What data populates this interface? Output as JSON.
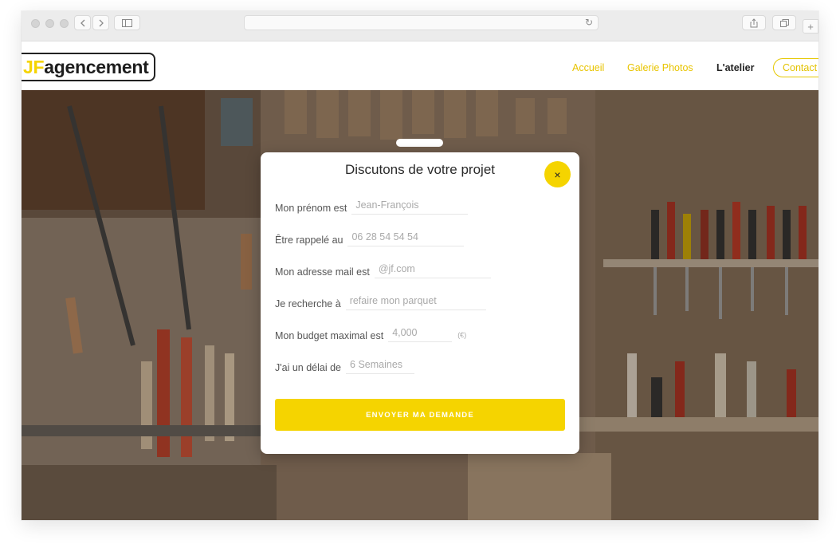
{
  "browser": {
    "back_icon": "chevron-left-icon",
    "forward_icon": "chevron-right-icon",
    "sidebar_icon": "sidebar-icon",
    "reload_icon": "reload-icon",
    "share_icon": "share-icon",
    "tabs_icon": "tabs-icon",
    "new_tab_icon": "plus-icon"
  },
  "nav": {
    "logo_prefix": "JF",
    "logo_suffix": "agencement",
    "links": [
      {
        "label": "Accueil",
        "active": false
      },
      {
        "label": "Galerie Photos",
        "active": false
      },
      {
        "label": "L'atelier",
        "active": true
      }
    ],
    "contact_label": "Contact"
  },
  "modal": {
    "title": "Discutons de votre projet",
    "close_symbol": "×",
    "fields": [
      {
        "label": "Mon prénom est",
        "placeholder": "Jean-François"
      },
      {
        "label": "Être rappelé au",
        "placeholder": "06 28 54 54 54"
      },
      {
        "label": "Mon adresse mail est",
        "placeholder": "@jf.com"
      },
      {
        "label": "Je recherche à",
        "placeholder": "refaire mon parquet"
      },
      {
        "label": "Mon budget maximal est",
        "placeholder": "4,000",
        "unit": "(€)"
      },
      {
        "label": "J'ai un délai de",
        "placeholder": "6 Semaines"
      }
    ],
    "submit_label": "ENVOYER MA DEMANDE"
  },
  "colors": {
    "accent": "#f5d400",
    "text": "#2a2a2a"
  }
}
